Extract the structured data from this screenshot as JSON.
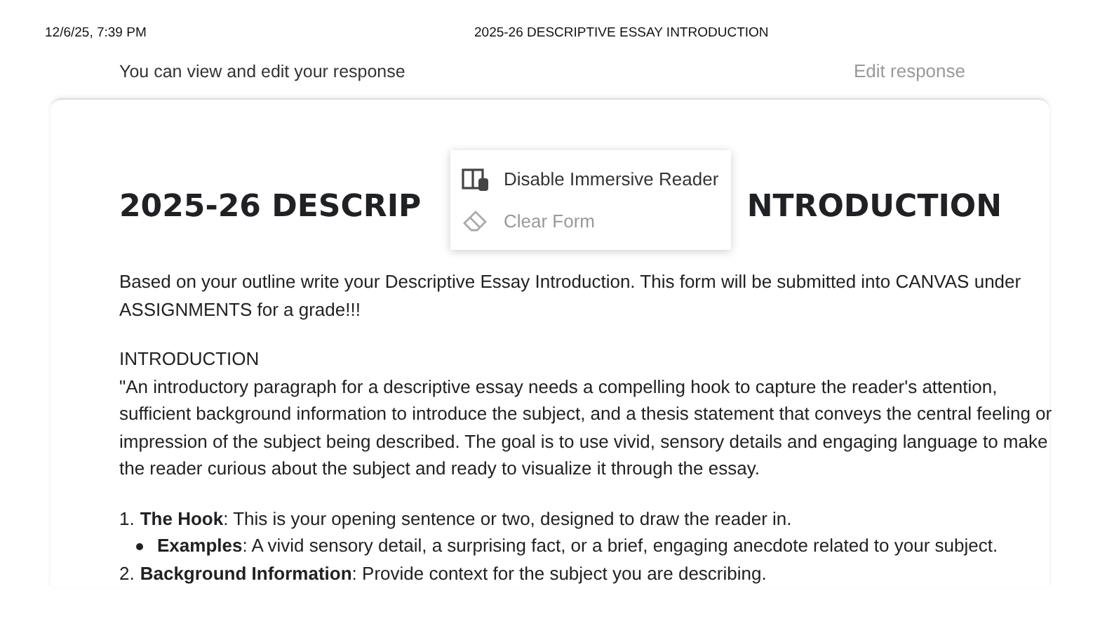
{
  "print_header": {
    "date": "12/6/25, 7:39 PM",
    "title": "2025-26 DESCRIPTIVE ESSAY INTRODUCTION"
  },
  "response_bar": {
    "message": "You can view and edit your response",
    "edit_link": "Edit response"
  },
  "form": {
    "title_parts": [
      "2025-26 DESCRIP",
      "NTRODUCTION"
    ],
    "paragraphs": [
      "Based on your outline write your Descriptive Essay Introduction.  This form will be submitted into CANVAS under ASSIGNMENTS for a grade!!!",
      "INTRODUCTION",
      "\"An introductory paragraph for a descriptive essay needs a compelling hook to capture the reader's attention, sufficient background information to introduce the subject, and a thesis statement that conveys the central feeling or impression of the subject being described. The goal is to use vivid, sensory details and engaging language to make the reader curious about the subject and ready to visualize it through the essay."
    ],
    "list": [
      {
        "number": "1.",
        "text": "**The Hook**: This is your opening sentence or two, designed to draw the reader in.",
        "children": [
          {
            "text": "**Examples**: A vivid sensory detail, a surprising fact, or a brief, engaging anecdote related to your subject."
          }
        ]
      },
      {
        "number": "2.",
        "text": "**Background Information**: Provide context for the subject you are describing."
      }
    ]
  },
  "menu": [
    {
      "kind": "reader",
      "label": "Disable Immersive Reader",
      "disabled": false
    },
    {
      "kind": "eraser",
      "label": "Clear Form",
      "disabled": true
    }
  ]
}
